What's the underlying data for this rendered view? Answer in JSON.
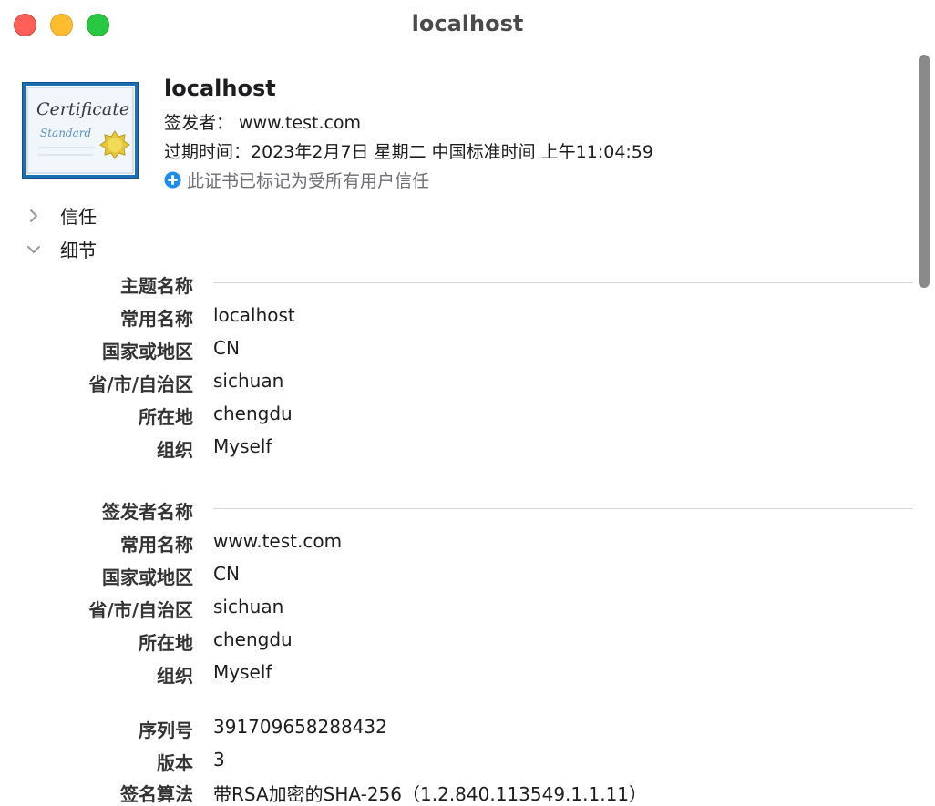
{
  "window": {
    "title": "localhost"
  },
  "certificate": {
    "icon_text_main": "Certificate",
    "icon_text_sub": "Standard",
    "name": "localhost",
    "issuer_line": "签发者：  www.test.com",
    "expiry_line": "过期时间：2023年2月7日 星期二 中国标准时间 上午11:04:59",
    "trust_status": "此证书已标记为受所有用户信任"
  },
  "sections": {
    "trust_label": "信任",
    "details_label": "细节"
  },
  "subject": {
    "header": "主题名称",
    "fields": [
      {
        "label": "常用名称",
        "value": "localhost"
      },
      {
        "label": "国家或地区",
        "value": "CN"
      },
      {
        "label": "省/市/自治区",
        "value": "sichuan"
      },
      {
        "label": "所在地",
        "value": "chengdu"
      },
      {
        "label": "组织",
        "value": "Myself"
      }
    ]
  },
  "issuer": {
    "header": "签发者名称",
    "fields": [
      {
        "label": "常用名称",
        "value": "www.test.com"
      },
      {
        "label": "国家或地区",
        "value": "CN"
      },
      {
        "label": "省/市/自治区",
        "value": "sichuan"
      },
      {
        "label": "所在地",
        "value": "chengdu"
      },
      {
        "label": "组织",
        "value": "Myself"
      }
    ]
  },
  "misc": {
    "fields": [
      {
        "label": "序列号",
        "value": "391709658288432"
      },
      {
        "label": "版本",
        "value": "3"
      },
      {
        "label": "签名算法",
        "value": "带RSA加密的SHA-256（1.2.840.113549.1.1.11）"
      }
    ]
  },
  "colors": {
    "close": "#fe5f57",
    "minimize": "#febc2e",
    "maximize": "#28c840",
    "accent": "#1e8bf0"
  }
}
